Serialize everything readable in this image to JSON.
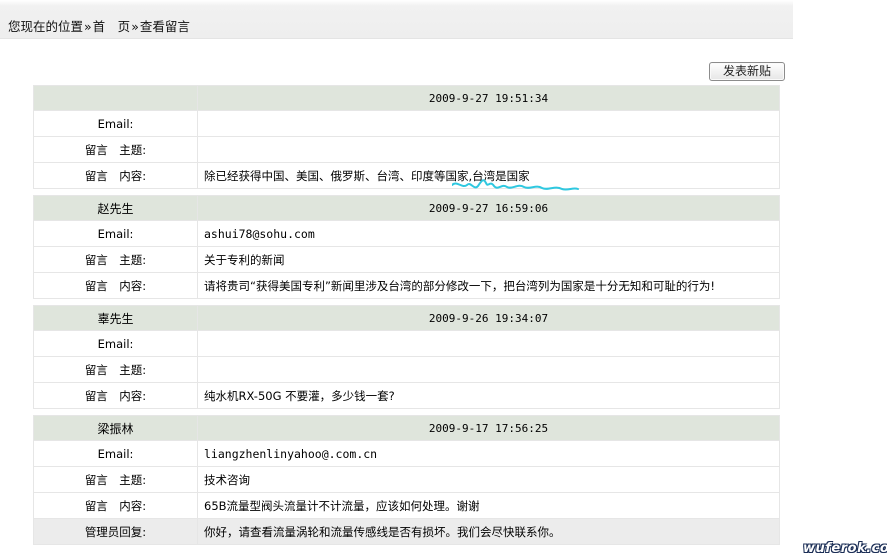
{
  "breadcrumb": {
    "prefix": "您现在的位置",
    "sep": "»",
    "home": "首　页",
    "current": "查看留言"
  },
  "toolbar": {
    "new_post_label": "发表新贴"
  },
  "labels": {
    "email": "Email:",
    "subject": "留言　主题:",
    "content": "留言　内容:",
    "admin_reply": "管理员回复:"
  },
  "messages": [
    {
      "name": "",
      "datetime": "2009-9-27 19:51:34",
      "email": "",
      "subject": "",
      "content": "除已经获得中国、美国、俄罗斯、台湾、印度等国家,台湾是国家"
    },
    {
      "name": "赵先生",
      "datetime": "2009-9-27 16:59:06",
      "email": "ashui78@sohu.com",
      "subject": "关于专利的新闻",
      "content": "请将贵司“获得美国专利”新闻里涉及台湾的部分修改一下，把台湾列为国家是十分无知和可耻的行为!"
    },
    {
      "name": "辜先生",
      "datetime": "2009-9-26 19:34:07",
      "email": "",
      "subject": "",
      "content": "纯水机RX-50G 不要灌，多少钱一套?"
    },
    {
      "name": "梁振林",
      "datetime": "2009-9-17 17:56:25",
      "email": "liangzhenlinyahoo@.com.cn",
      "subject": "技术咨询",
      "content": "65B流量型阀头流量计不计流量，应该如何处理。谢谢",
      "admin_reply": "你好，请查看流量涡轮和流量传感线是否有损坏。我们会尽快联系你。"
    }
  ],
  "watermark": "wuferok.com",
  "colors": {
    "header_row_bg": "#dfe5dc",
    "admin_row_bg": "#ececec",
    "annotation_squiggle": "#2fc8e0",
    "border": "#e6e6e6"
  }
}
